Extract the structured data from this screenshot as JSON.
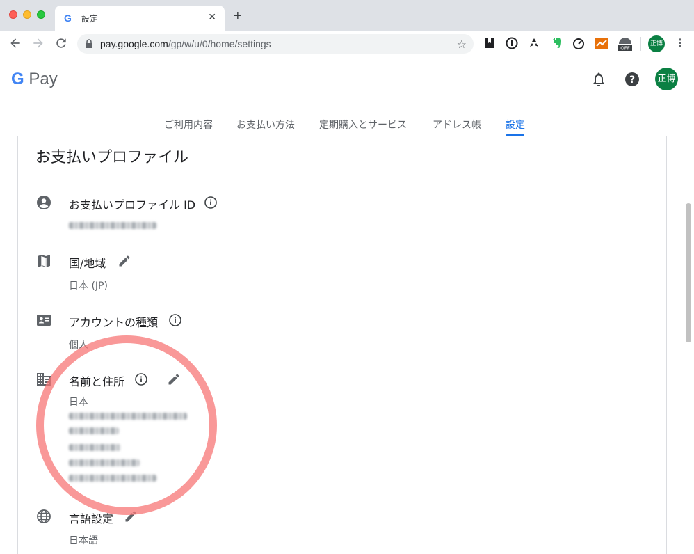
{
  "browser": {
    "tab_title": "設定",
    "tab_close": "✕",
    "new_tab": "+",
    "url_host": "pay.google.com",
    "url_path": "/gp/w/u/0/home/settings",
    "star": "☆",
    "profile_initials": "正博",
    "menu": "⋮"
  },
  "header": {
    "logo_g": "G",
    "logo_text": " Pay",
    "avatar_initials": "正博"
  },
  "nav": {
    "tabs": [
      {
        "label": "ご利用内容"
      },
      {
        "label": "お支払い方法"
      },
      {
        "label": "定期購入とサービス"
      },
      {
        "label": "アドレス帳"
      },
      {
        "label": "設定"
      }
    ],
    "active_index": 4
  },
  "settings": {
    "section_title": "お支払いプロファイル",
    "rows": [
      {
        "label": "お支払いプロファイル ID",
        "icon": "account-circle-icon",
        "value": ""
      },
      {
        "label": "国/地域",
        "icon": "map-icon",
        "value": "日本 (JP)"
      },
      {
        "label": "アカウントの種類",
        "icon": "contact-card-icon",
        "value": "個人"
      },
      {
        "label": "名前と住所",
        "icon": "building-icon",
        "value": "日本"
      },
      {
        "label": "言語設定",
        "icon": "globe-icon",
        "value": "日本語"
      }
    ]
  },
  "colors": {
    "accent": "#1a73e8",
    "avatar": "#0b8043",
    "highlight": "#f77676"
  }
}
